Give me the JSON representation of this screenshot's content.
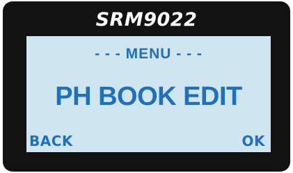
{
  "device": {
    "model": "SRM9022"
  },
  "screen": {
    "menu_header": "- - - MENU - - -",
    "main_label": "PH BOOK EDIT",
    "left_softkey": "BACK",
    "right_softkey": "OK"
  },
  "colors": {
    "bezel": "#121212",
    "screen_background": "#cfe5f0",
    "screen_text": "#1f6fbf",
    "title_text": "#ffffff"
  }
}
